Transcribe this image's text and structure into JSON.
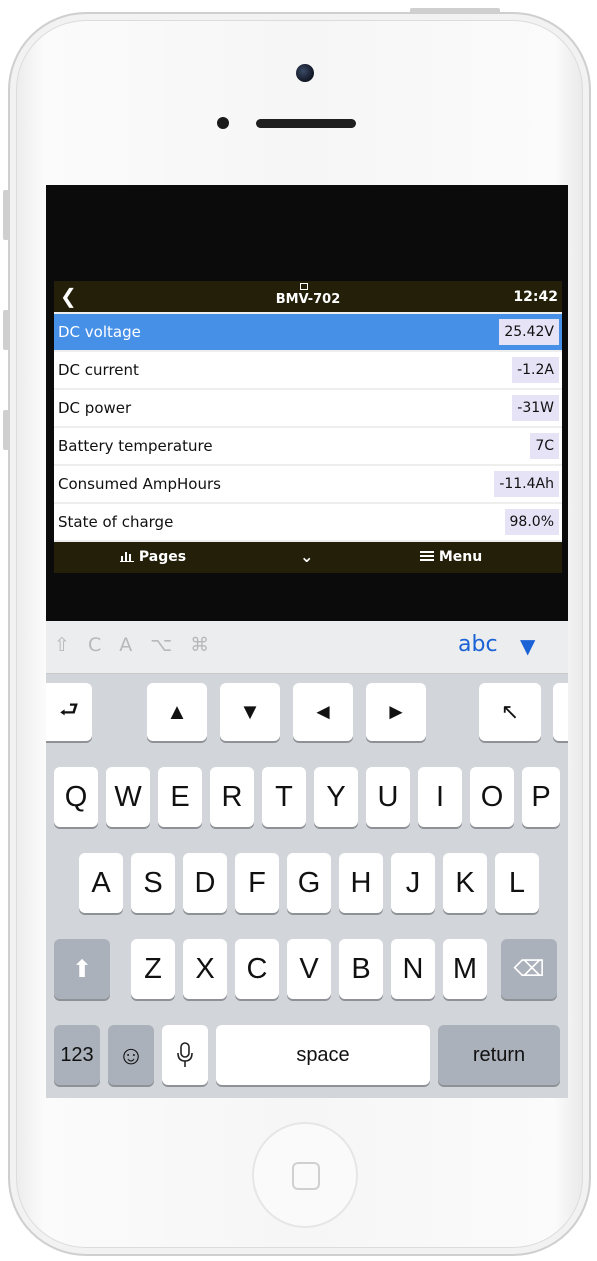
{
  "app": {
    "title": "BMV-702",
    "time": "12:42",
    "back_icon": "chevron-left-icon",
    "rows": [
      {
        "label": "DC voltage",
        "value": "25.42V",
        "selected": true
      },
      {
        "label": "DC current",
        "value": "-1.2A"
      },
      {
        "label": "DC power",
        "value": "-31W"
      },
      {
        "label": "Battery temperature",
        "value": "7C"
      },
      {
        "label": "Consumed AmpHours",
        "value": "-11.4Ah"
      },
      {
        "label": "State of charge",
        "value": "98.0%"
      }
    ],
    "bottom": {
      "pages": "Pages",
      "pages_icon": "bar-chart-icon",
      "chevron": "⌄",
      "menu": "Menu",
      "menu_icon": "hamburger-icon"
    },
    "colors": {
      "bar": "#231f08",
      "selected_row": "#4690e8",
      "value_badge": "#e6e3f7"
    }
  },
  "keyboard": {
    "toolbar": {
      "modifiers": "⇧ C A ⌥ ⌘",
      "abc": "abc",
      "hide": "▼"
    },
    "special_row": [
      "⮐",
      "▲",
      "▼",
      "◄",
      "►",
      "↖"
    ],
    "row1": [
      "Q",
      "W",
      "E",
      "R",
      "T",
      "Y",
      "U",
      "I",
      "O",
      "P"
    ],
    "row2": [
      "A",
      "S",
      "D",
      "F",
      "G",
      "H",
      "J",
      "K",
      "L"
    ],
    "row3": [
      "Z",
      "X",
      "C",
      "V",
      "B",
      "N",
      "M"
    ],
    "shift": "⬆",
    "delete": "⌫",
    "numbers": "123",
    "emoji": "☺",
    "mic": "🎙",
    "space": "space",
    "return": "return"
  }
}
